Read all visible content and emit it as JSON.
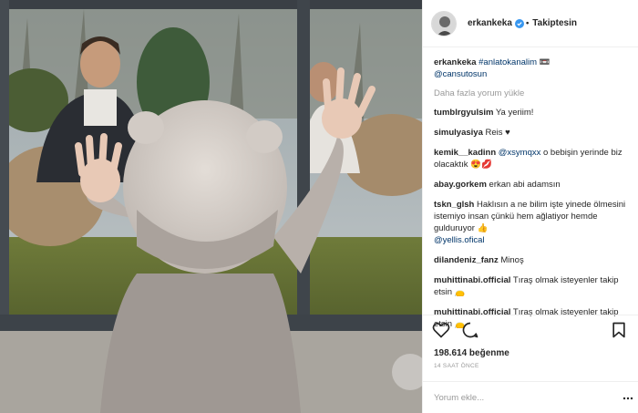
{
  "colors": {
    "link": "#003569",
    "muted": "#999999",
    "text": "#262626",
    "verified": "#3897f0"
  },
  "header": {
    "username": "erkankeka",
    "separator": "•",
    "follow_label": "Takiptesin",
    "verified_icon": "verified-badge-icon"
  },
  "caption": {
    "username": "erkankeka",
    "hashtag": "#anlatokanalim",
    "emoji": "📼",
    "mention": "@cansutosun"
  },
  "load_more_label": "Daha fazla yorum yükle",
  "comments": [
    {
      "user": "tumblrgyulsim",
      "text": "Ya yeriim!"
    },
    {
      "user": "simulyasiya",
      "text": "Reis ♥"
    },
    {
      "user": "kemik__kadinn",
      "mention": "@xsymqxx",
      "text": "o bebişin yerinde biz olacaktık 😍💋"
    },
    {
      "user": "abay.gorkem",
      "text": "erkan abi adamsın"
    },
    {
      "user": "tskn_glsh",
      "text": "Haklısın a ne bilim işte yinede ölmesini istemiyo insan çünkü hem ağlatiyor hemde gulduruyor 👍",
      "mention": "@yellis.ofical"
    },
    {
      "user": "dilandeniz_fanz",
      "text": "Minoş"
    },
    {
      "user": "muhittinabi.official",
      "text": "Tıraş olmak isteyenler takip etsin 👝"
    },
    {
      "user": "muhittinabi.official",
      "text": "Tıraş olmak isteyenler takip etsin 👝"
    }
  ],
  "actions": {
    "like_icon": "heart-icon",
    "comment_icon": "comment-icon",
    "save_icon": "bookmark-icon"
  },
  "likes_label": "198.614 beğenme",
  "time_label": "14 SAAT ÖNCE",
  "add_comment": {
    "placeholder": "Yorum ekle..."
  },
  "more_icon": "more-dots-icon",
  "photo": {
    "description_icon": "photo-image"
  }
}
